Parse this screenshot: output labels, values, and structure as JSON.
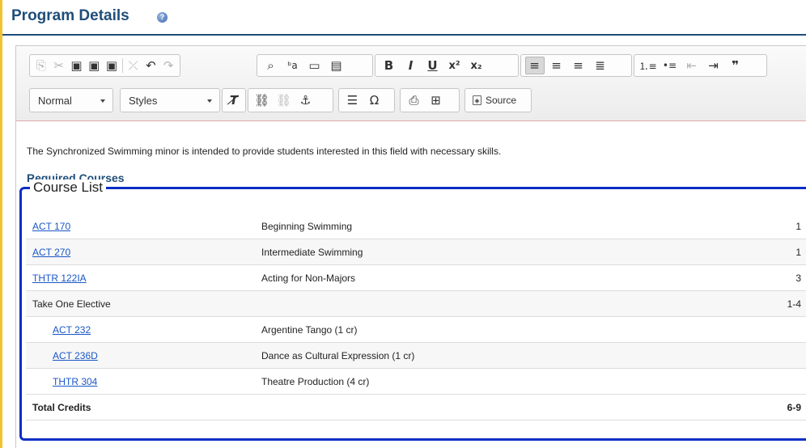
{
  "header": {
    "title": "Program Details",
    "help_icon": "question-icon"
  },
  "toolbar": {
    "row1": [
      [
        "copy-icon",
        "⎘",
        true
      ],
      [
        "cut-icon",
        "✂",
        true
      ],
      [
        "paste-icon",
        "📋",
        false
      ],
      [
        "paste-text-icon",
        "📋",
        false
      ],
      [
        "paste-word-icon",
        "📋",
        false
      ],
      [
        "remove-format-icon",
        "✕",
        true
      ],
      [
        "undo-icon",
        "↶",
        false
      ],
      [
        "redo-icon",
        "↷",
        true
      ],
      [
        "find-icon",
        "🔍",
        false
      ],
      [
        "replace-icon",
        "ᵇa",
        false
      ],
      [
        "select-all-icon",
        "▭",
        false
      ],
      [
        "spellcheck-icon",
        "▤",
        false
      ],
      [
        "bold-icon",
        "B",
        false
      ],
      [
        "italic-icon",
        "I",
        false
      ],
      [
        "underline-icon",
        "U",
        false
      ],
      [
        "superscript-icon",
        "x²",
        false
      ],
      [
        "subscript-icon",
        "x₂",
        false
      ],
      [
        "align-left-icon",
        "≡",
        false
      ],
      [
        "align-center-icon",
        "≡",
        false
      ],
      [
        "align-right-icon",
        "≡",
        false
      ],
      [
        "justify-icon",
        "≡",
        false
      ],
      [
        "numbered-list-icon",
        "⒈",
        false
      ],
      [
        "bulleted-list-icon",
        "•",
        false
      ],
      [
        "outdent-icon",
        "⇤",
        true
      ],
      [
        "indent-icon",
        "⇥",
        true
      ],
      [
        "blockquote-icon",
        "❞",
        false
      ]
    ],
    "format_value": "Normal",
    "styles_value": "Styles",
    "source_label": "Source"
  },
  "content": {
    "intro": "The Synchronized Swimming minor is intended to provide students interested in this field with necessary skills.",
    "section_heading": "Required Courses",
    "course_list_legend": "Course List",
    "rows": [
      {
        "code": "ACT 170",
        "title": "Beginning Swimming",
        "credits": "1",
        "link": true,
        "indent": false
      },
      {
        "code": "ACT 270",
        "title": "Intermediate Swimming",
        "credits": "1",
        "link": true,
        "indent": false
      },
      {
        "code": "THTR 122IA",
        "title": "Acting for Non-Majors",
        "credits": "3",
        "link": true,
        "indent": false
      },
      {
        "code": "Take One Elective",
        "title": "",
        "credits": "1-4",
        "link": false,
        "indent": false
      },
      {
        "code": "ACT 232",
        "title": "Argentine Tango (1 cr)",
        "credits": "",
        "link": true,
        "indent": true
      },
      {
        "code": "ACT 236D",
        "title": "Dance as Cultural Expression (1 cr)",
        "credits": "",
        "link": true,
        "indent": true
      },
      {
        "code": "THTR 304",
        "title": "Theatre Production (4 cr)",
        "credits": "",
        "link": true,
        "indent": true
      }
    ],
    "total_label": "Total Credits",
    "total_credits": "6-9"
  },
  "colors": {
    "heading": "#1f4e79",
    "link": "#1a56c7",
    "course_list_border": "#0b2ec4",
    "accent_rule": "#f1c232"
  }
}
